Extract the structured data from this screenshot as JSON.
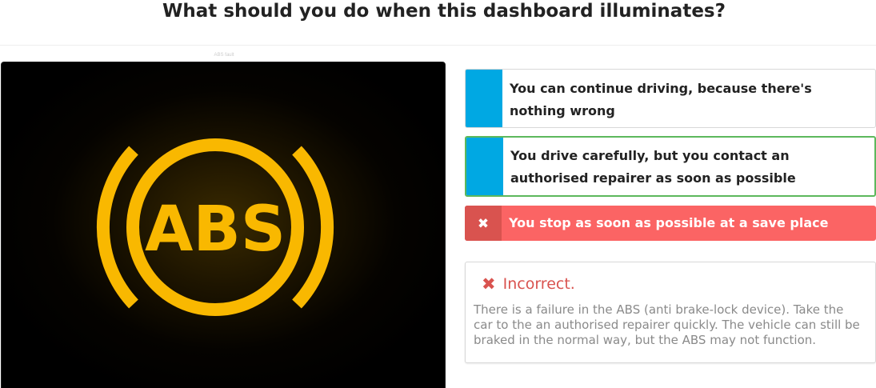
{
  "question": "What should you do when this dashboard illuminates?",
  "image": {
    "caption": "ABS fault",
    "symbol_text": "ABS",
    "symbol_color": "#f9b800",
    "background": "#000000"
  },
  "answers": [
    {
      "text": "You can continue driving, because there's nothing wrong",
      "state": "neutral"
    },
    {
      "text": "You drive carefully, but you contact an authorised repairer as soon as possible",
      "state": "correct"
    },
    {
      "text": "You stop as soon as possible at a save place",
      "state": "selected-wrong",
      "mark_icon": "x-icon"
    }
  ],
  "feedback": {
    "icon": "x-icon",
    "title": "Incorrect.",
    "body": "There is a failure in the ABS (anti brake-lock device). Take the car to the an authorised repairer quickly. The vehicle can still be braked in the normal way, but the ABS may not function."
  },
  "colors": {
    "answer_tab": "#00a8e3",
    "correct_border": "#5cb85c",
    "wrong_bg": "#fb6464",
    "wrong_tab": "#d9534f",
    "incorrect_text": "#d9534f"
  }
}
